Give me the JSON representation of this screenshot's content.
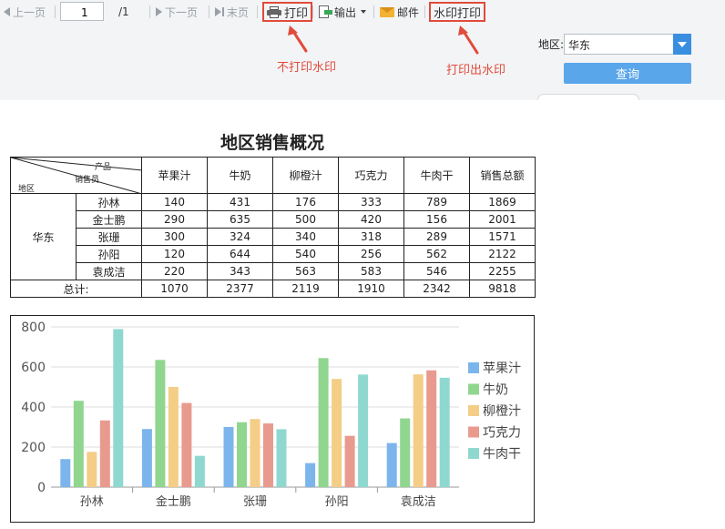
{
  "toolbar": {
    "prev_page": "上一页",
    "page_value": "1",
    "page_total": "/1",
    "next_page": "下一页",
    "last_page": "末页",
    "print": "打印",
    "export": "输出",
    "mail": "邮件",
    "watermark_print": "水印打印"
  },
  "annotations": {
    "no_watermark": "不打印水印",
    "with_watermark": "打印出水印"
  },
  "filter": {
    "region_label": "地区:",
    "region_value": "华东",
    "query_button": "查询"
  },
  "report": {
    "title": "地区销售概况",
    "header_product": "产品",
    "header_salesperson": "销售员",
    "header_region": "地区",
    "columns": [
      "苹果汁",
      "牛奶",
      "柳橙汁",
      "巧克力",
      "牛肉干",
      "销售总额"
    ],
    "region": "华东",
    "rows": [
      {
        "name": "孙林",
        "values": [
          "140",
          "431",
          "176",
          "333",
          "789",
          "1869"
        ]
      },
      {
        "name": "金士鹏",
        "values": [
          "290",
          "635",
          "500",
          "420",
          "156",
          "2001"
        ]
      },
      {
        "name": "张珊",
        "values": [
          "300",
          "324",
          "340",
          "318",
          "289",
          "1571"
        ]
      },
      {
        "name": "孙阳",
        "values": [
          "120",
          "644",
          "540",
          "256",
          "562",
          "2122"
        ]
      },
      {
        "name": "袁成洁",
        "values": [
          "220",
          "343",
          "563",
          "583",
          "546",
          "2255"
        ]
      }
    ],
    "total_label": "总计:",
    "totals": [
      "1070",
      "2377",
      "2119",
      "1910",
      "2342",
      "9818"
    ]
  },
  "chart_data": {
    "type": "bar",
    "categories": [
      "孙林",
      "金士鹏",
      "张珊",
      "孙阳",
      "袁成洁"
    ],
    "series": [
      {
        "name": "苹果汁",
        "values": [
          140,
          290,
          300,
          120,
          220
        ],
        "color": "#7cb5ec"
      },
      {
        "name": "牛奶",
        "values": [
          431,
          635,
          324,
          644,
          343
        ],
        "color": "#90d68f"
      },
      {
        "name": "柳橙汁",
        "values": [
          176,
          500,
          340,
          540,
          563
        ],
        "color": "#f4cd87"
      },
      {
        "name": "巧克力",
        "values": [
          333,
          420,
          318,
          256,
          583
        ],
        "color": "#e99a8e"
      },
      {
        "name": "牛肉干",
        "values": [
          789,
          156,
          289,
          562,
          546
        ],
        "color": "#8fd8d0"
      }
    ],
    "yticks": [
      0,
      200,
      400,
      600,
      800
    ],
    "ylim": [
      0,
      800
    ],
    "grid": true,
    "legend": "right"
  }
}
